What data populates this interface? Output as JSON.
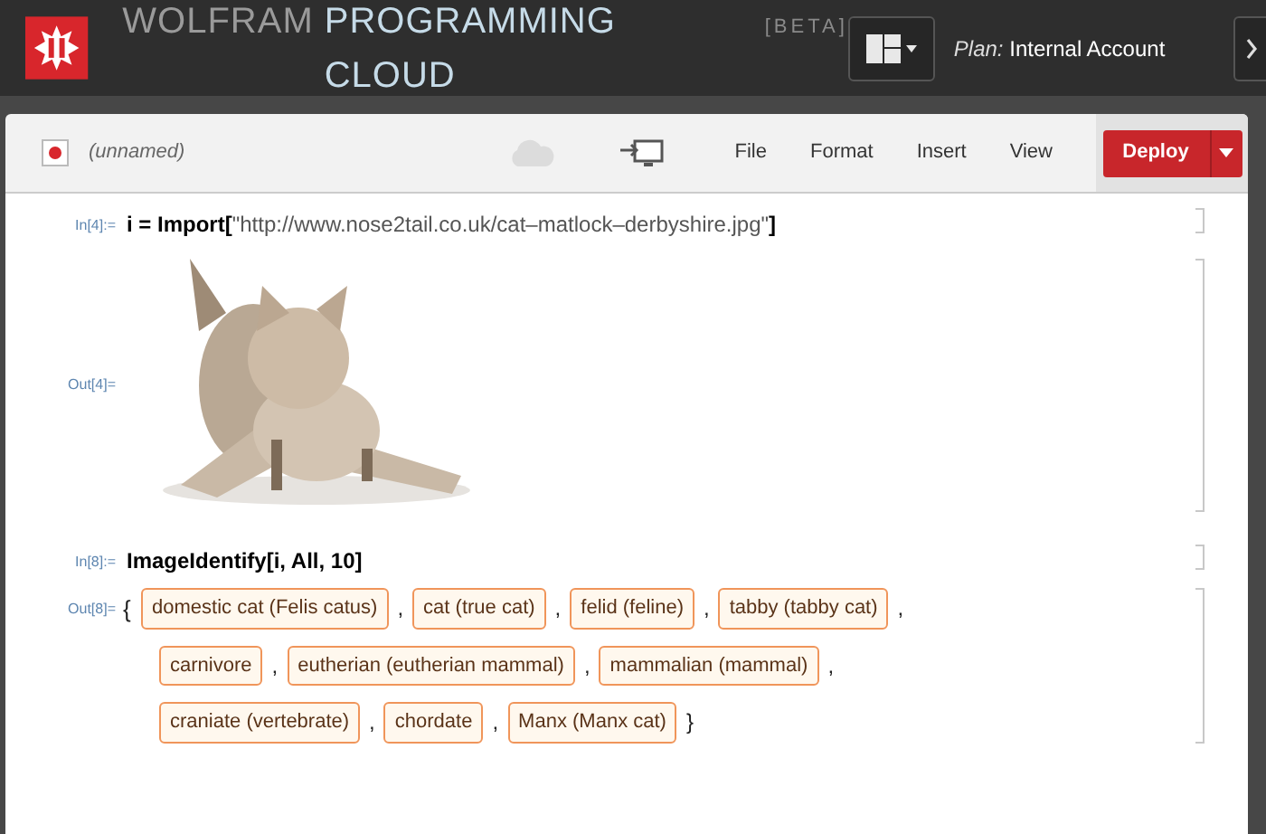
{
  "header": {
    "brand": "WOLFRAM",
    "product": "PROGRAMMING CLOUD",
    "tag": "[BETA]",
    "plan_label": "Plan:",
    "plan_value": "Internal Account"
  },
  "toolbar": {
    "notebook_name": "(unnamed)",
    "menus": [
      "File",
      "Format",
      "Insert",
      "View"
    ],
    "deploy": "Deploy"
  },
  "cells": [
    {
      "in_label": "In[4]:=",
      "code": [
        {
          "kind": "code",
          "text": "i = Import["
        },
        {
          "kind": "string",
          "text": "\"http://www.nose2tail.co.uk/cat–matlock–derbyshire.jpg\""
        },
        {
          "kind": "code",
          "text": "]"
        }
      ],
      "out_label": "Out[4]=",
      "output": {
        "kind": "picture"
      }
    },
    {
      "in_label": "In[8]:=",
      "code": [
        {
          "kind": "code",
          "text": "ImageIdentify[i, All, 10]"
        }
      ],
      "out_label": "Out[8]=",
      "output": {
        "kind": "list",
        "open": "{",
        "lines": [
          [
            {
              "label": "domestic cat (Felis catus)",
              "after": ","
            },
            {
              "label": "cat (true cat)",
              "after": ","
            },
            {
              "label": "felid (feline)",
              "after": ","
            },
            {
              "label": "tabby (tabby cat)",
              "after": ","
            }
          ],
          [
            {
              "label": "carnivore",
              "after": ","
            },
            {
              "label": "eutherian (eutherian mammal)",
              "after": ","
            },
            {
              "label": "mammalian (mammal)",
              "after": ","
            }
          ],
          [
            {
              "label": "craniate (vertebrate)",
              "after": ","
            },
            {
              "label": "chordate",
              "after": ","
            },
            {
              "label": "Manx (Manx cat)",
              "after": "}"
            }
          ]
        ]
      }
    }
  ]
}
